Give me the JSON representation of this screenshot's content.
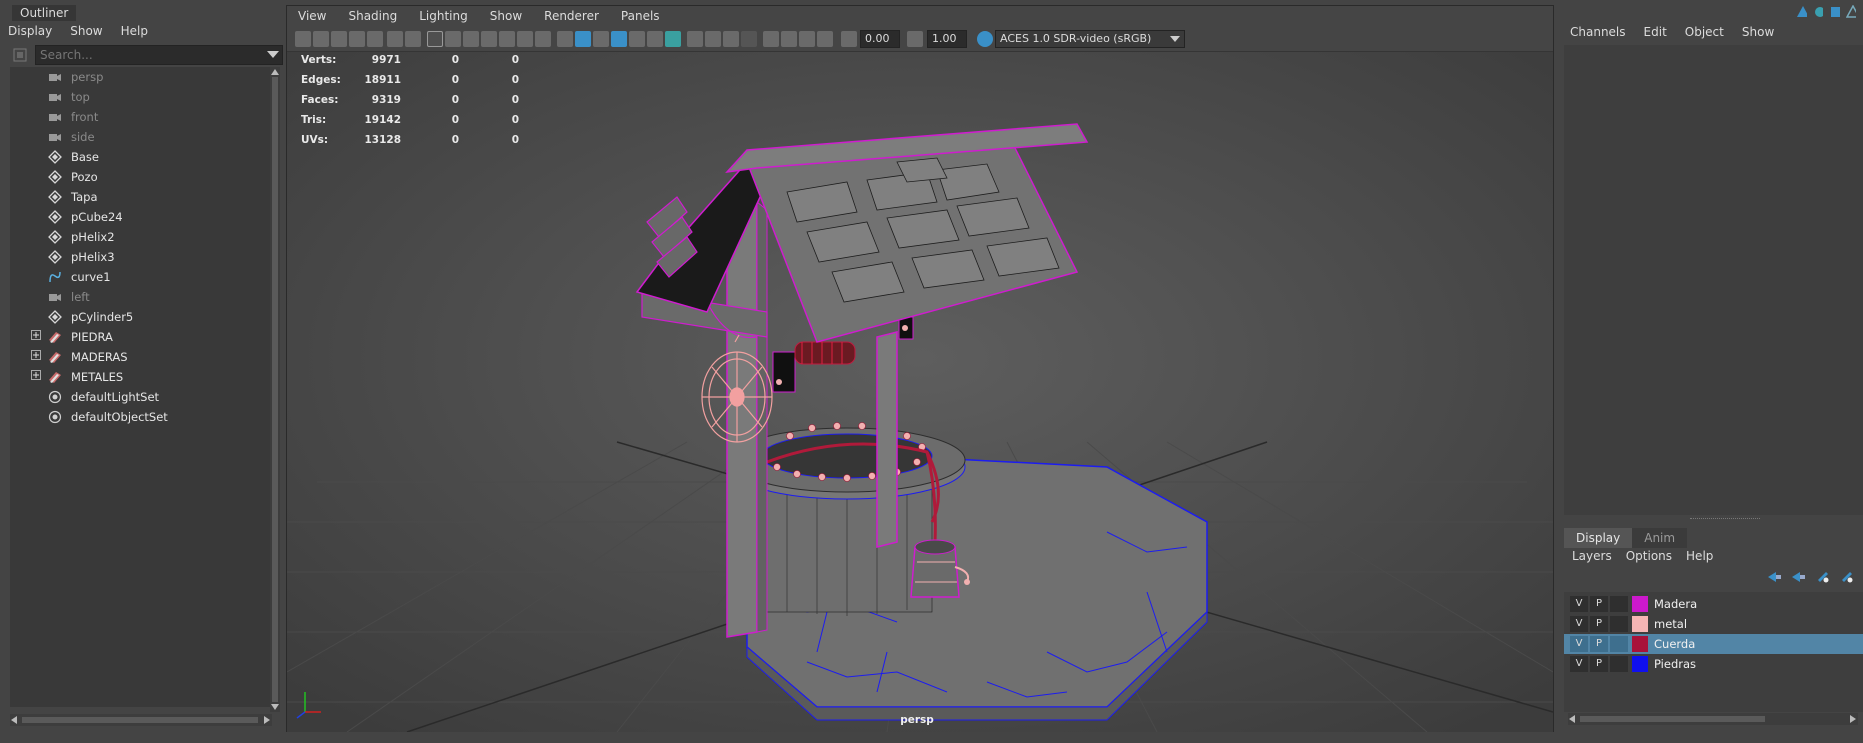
{
  "outliner": {
    "title": "Outliner",
    "menu": [
      "Display",
      "Show",
      "Help"
    ],
    "search_placeholder": "Search...",
    "items": [
      {
        "label": "persp",
        "icon": "camera-icon",
        "dim": true,
        "expandable": false
      },
      {
        "label": "top",
        "icon": "camera-icon",
        "dim": true,
        "expandable": false
      },
      {
        "label": "front",
        "icon": "camera-icon",
        "dim": true,
        "expandable": false
      },
      {
        "label": "side",
        "icon": "camera-icon",
        "dim": true,
        "expandable": false
      },
      {
        "label": "Base",
        "icon": "mesh-icon",
        "dim": false,
        "expandable": false
      },
      {
        "label": "Pozo",
        "icon": "mesh-icon",
        "dim": false,
        "expandable": false
      },
      {
        "label": "Tapa",
        "icon": "mesh-icon",
        "dim": false,
        "expandable": false
      },
      {
        "label": "pCube24",
        "icon": "mesh-icon",
        "dim": false,
        "expandable": false
      },
      {
        "label": "pHelix2",
        "icon": "mesh-icon",
        "dim": false,
        "expandable": false
      },
      {
        "label": "pHelix3",
        "icon": "mesh-icon",
        "dim": false,
        "expandable": false
      },
      {
        "label": "curve1",
        "icon": "curve-icon",
        "dim": false,
        "expandable": false
      },
      {
        "label": "left",
        "icon": "camera-icon",
        "dim": true,
        "expandable": false
      },
      {
        "label": "pCylinder5",
        "icon": "mesh-icon",
        "dim": false,
        "expandable": false
      },
      {
        "label": "PIEDRA",
        "icon": "group-icon",
        "dim": false,
        "expandable": true
      },
      {
        "label": "MADERAS",
        "icon": "group-icon",
        "dim": false,
        "expandable": true
      },
      {
        "label": "METALES",
        "icon": "group-icon",
        "dim": false,
        "expandable": true
      },
      {
        "label": "defaultLightSet",
        "icon": "set-icon",
        "dim": false,
        "expandable": false
      },
      {
        "label": "defaultObjectSet",
        "icon": "set-icon",
        "dim": false,
        "expandable": false
      }
    ]
  },
  "viewport": {
    "menu": [
      "View",
      "Shading",
      "Lighting",
      "Show",
      "Renderer",
      "Panels"
    ],
    "exposure_value": "0.00",
    "gamma_value": "1.00",
    "color_space": "ACES 1.0 SDR-video (sRGB)",
    "camera_label": "persp",
    "hud": [
      {
        "label": "Verts:",
        "v1": "9971",
        "v2": "0",
        "v3": "0"
      },
      {
        "label": "Edges:",
        "v1": "18911",
        "v2": "0",
        "v3": "0"
      },
      {
        "label": "Faces:",
        "v1": "9319",
        "v2": "0",
        "v3": "0"
      },
      {
        "label": "Tris:",
        "v1": "19142",
        "v2": "0",
        "v3": "0"
      },
      {
        "label": "UVs:",
        "v1": "13128",
        "v2": "0",
        "v3": "0"
      }
    ]
  },
  "channel_box": {
    "menu": [
      "Channels",
      "Edit",
      "Object",
      "Show"
    ]
  },
  "layer_editor": {
    "tabs": [
      "Display",
      "Anim"
    ],
    "menu": [
      "Layers",
      "Options",
      "Help"
    ],
    "layers": [
      {
        "v": "V",
        "p": "P",
        "name": "Madera",
        "color": "#cc19cc",
        "selected": false
      },
      {
        "v": "V",
        "p": "P",
        "name": "metal",
        "color": "#f5b5b5",
        "selected": false
      },
      {
        "v": "V",
        "p": "P",
        "name": "Cuerda",
        "color": "#a8123a",
        "selected": true
      },
      {
        "v": "V",
        "p": "P",
        "name": "Piedras",
        "color": "#1010ee",
        "selected": false
      }
    ]
  }
}
